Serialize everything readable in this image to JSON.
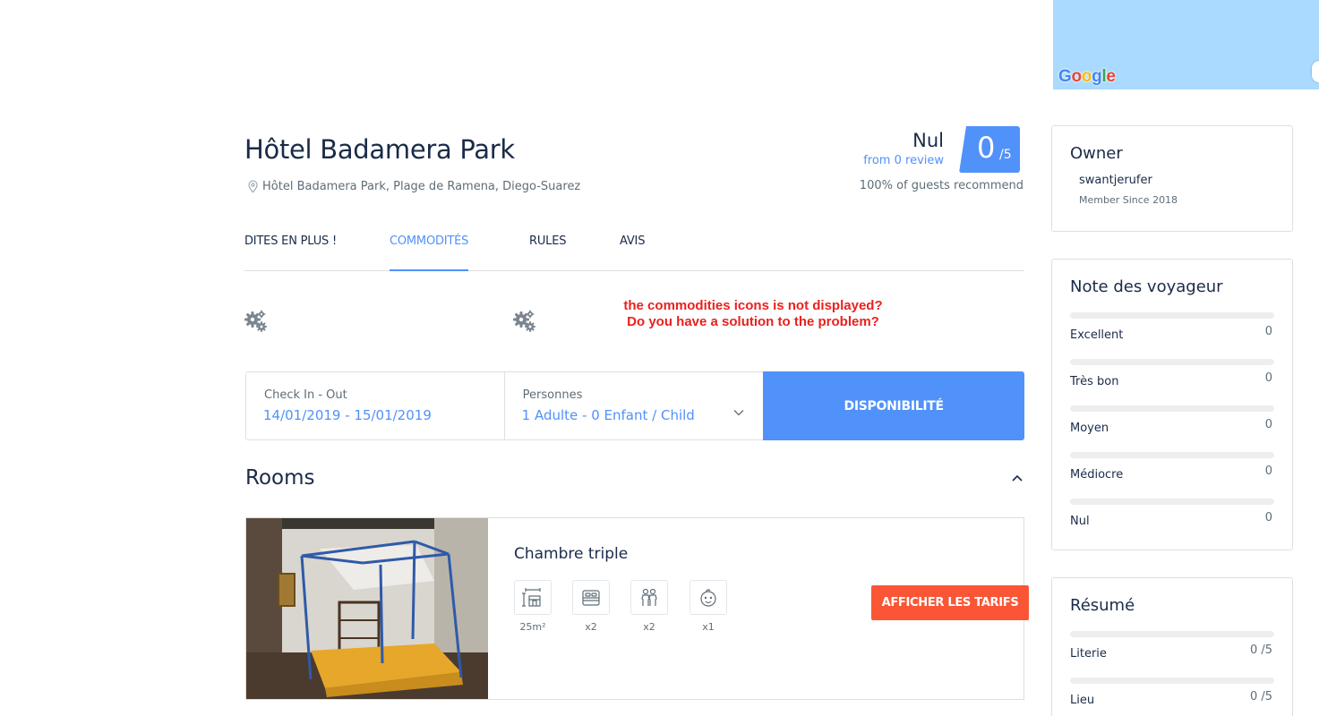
{
  "map": {
    "provider": "Google"
  },
  "hotel": {
    "name": "Hôtel Badamera Park",
    "address": "Hôtel Badamera Park, Plage de Ramena, Diego-Suarez"
  },
  "rating": {
    "word": "Nul",
    "reviews_link": "from 0 review",
    "score": "0",
    "scale": "/5",
    "recommend": "100% of guests recommend"
  },
  "tabs": [
    "DITES EN PLUS !",
    "COMMODITÉS",
    "RULES",
    "AVIS"
  ],
  "active_tab": "COMMODITÉS",
  "annotation": {
    "line1": "the commodities icons is not displayed?",
    "line2": "Do you have a solution to the problem?"
  },
  "search": {
    "checkin_label": "Check In - Out",
    "checkin_value": "14/01/2019 - 15/01/2019",
    "guests_label": "Personnes",
    "guests_value": "1 Adulte - 0 Enfant / Child",
    "button": "DISPONIBILITÉ"
  },
  "rooms": {
    "title": "Rooms",
    "items": [
      {
        "name": "Chambre triple",
        "facilities": [
          {
            "icon": "room-size-icon",
            "value": "25m²"
          },
          {
            "icon": "bed-icon",
            "value": "x2"
          },
          {
            "icon": "adults-icon",
            "value": "x2"
          },
          {
            "icon": "child-icon",
            "value": "x1"
          }
        ],
        "button": "AFFICHER LES TARIFS"
      }
    ]
  },
  "owner": {
    "title": "Owner",
    "username": "swantjerufer",
    "since": "Member Since 2018"
  },
  "traveler_reviews": {
    "title": "Note des voyageur",
    "rows": [
      {
        "label": "Excellent",
        "count": "0",
        "fraction": 0
      },
      {
        "label": "Très bon",
        "count": "0",
        "fraction": 0
      },
      {
        "label": "Moyen",
        "count": "0",
        "fraction": 0
      },
      {
        "label": "Médiocre",
        "count": "0",
        "fraction": 0
      },
      {
        "label": "Nul",
        "count": "0",
        "fraction": 0
      }
    ]
  },
  "summary": {
    "title": "Résumé",
    "rows": [
      {
        "label": "Literie",
        "score": "0 /5",
        "fraction": 0
      },
      {
        "label": "Lieu",
        "score": "0 /5",
        "fraction": 0
      }
    ]
  },
  "colors": {
    "accent": "#5191fa",
    "cta": "#fa5636",
    "text": "#1a2b49",
    "annotation": "#e8211f"
  }
}
